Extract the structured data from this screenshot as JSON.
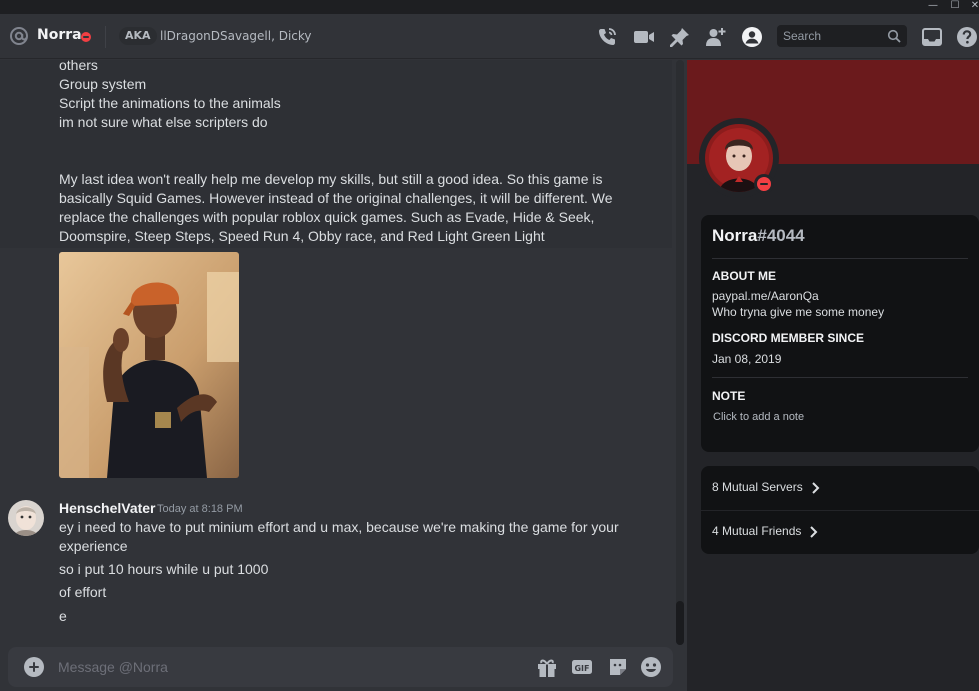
{
  "window": {
    "minimize": "—",
    "maximize": "☐",
    "close": "✕"
  },
  "header": {
    "name": "Norra",
    "aka_label": "AKA",
    "aka_names": "llDragonDSavagell, Dicky",
    "search_placeholder": "Search"
  },
  "messages": {
    "earlier_lines": [
      "others",
      "Group system",
      "Script the animations to the animals",
      "im not sure what else scripters do",
      "",
      "",
      "My last idea won't really help me develop my skills, but still a good idea. So this game is",
      "basically Squid Games. However instead of the original challenges, it will be different. We",
      "replace the challenges with popular roblox quick games. Such as Evade, Hide & Seek,",
      "Doomspire, Steep Steps, Speed Run 4, Obby race, and Red Light Green Light"
    ],
    "last_author": "HenschelVater",
    "last_time": "Today at 8:18 PM",
    "last_lines": [
      "ey i need to have to put minium effort and u max, because we're making the game for your",
      "experience",
      "so i put 10 hours while u put 1000",
      "of effort",
      "e"
    ]
  },
  "composer": {
    "placeholder": "Message @Norra"
  },
  "profile": {
    "display_name": "Norra",
    "discriminator": "#4044",
    "about_title": "ABOUT ME",
    "about_lines": [
      "paypal.me/AaronQa",
      "Who tryna give me some money"
    ],
    "member_since_title": "DISCORD MEMBER SINCE",
    "member_since": "Jan 08, 2019",
    "note_title": "NOTE",
    "note_placeholder": "Click to add a note",
    "mutual_servers": "8 Mutual Servers",
    "mutual_friends": "4 Mutual Friends"
  },
  "colors": {
    "background": "#313338",
    "panel": "#232428",
    "card": "#111214",
    "banner": "#6b1a1c",
    "dnd": "#f23f43"
  },
  "icons": [
    "at-icon",
    "phone-icon",
    "video-icon",
    "pin-icon",
    "add-friend-icon",
    "profile-toggle-icon",
    "search-icon",
    "inbox-icon",
    "help-icon",
    "plus-icon",
    "gift-icon",
    "gif-icon",
    "sticker-icon",
    "emoji-icon",
    "chevron-right-icon"
  ]
}
